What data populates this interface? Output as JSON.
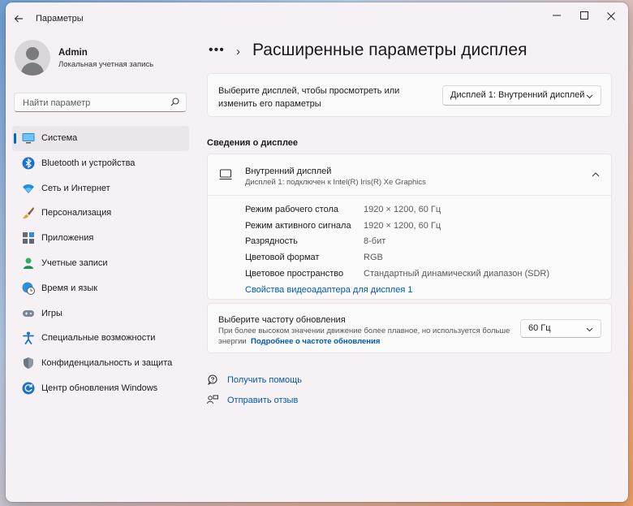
{
  "window": {
    "title": "Параметры",
    "back_icon": "arrow-left-icon",
    "controls": [
      "minimize",
      "maximize",
      "close"
    ]
  },
  "user": {
    "name": "Admin",
    "account_type": "Локальная учетная запись"
  },
  "search": {
    "placeholder": "Найти параметр"
  },
  "sidebar": {
    "items": [
      {
        "label": "Система",
        "icon": "system-display-icon",
        "active": true
      },
      {
        "label": "Bluetooth и устройства",
        "icon": "bluetooth-icon"
      },
      {
        "label": "Сеть и Интернет",
        "icon": "wifi-icon"
      },
      {
        "label": "Персонализация",
        "icon": "brush-icon"
      },
      {
        "label": "Приложения",
        "icon": "apps-icon"
      },
      {
        "label": "Учетные записи",
        "icon": "accounts-icon"
      },
      {
        "label": "Время и язык",
        "icon": "globe-clock-icon"
      },
      {
        "label": "Игры",
        "icon": "gamepad-icon"
      },
      {
        "label": "Специальные возможности",
        "icon": "accessibility-icon"
      },
      {
        "label": "Конфиденциальность и защита",
        "icon": "shield-icon"
      },
      {
        "label": "Центр обновления Windows",
        "icon": "windows-update-icon"
      }
    ]
  },
  "header": {
    "more": "•••",
    "separator": "›",
    "title": "Расширенные параметры дисплея"
  },
  "display_select": {
    "label": "Выберите дисплей, чтобы просмотреть или изменить его параметры",
    "selected": "Дисплей 1: Внутренний дисплей"
  },
  "info_section": {
    "heading": "Сведения о дисплее",
    "display_name": "Внутренний дисплей",
    "display_desc": "Дисплей 1: подключен к Intel(R) Iris(R) Xe Graphics",
    "properties": [
      {
        "key": "Режим рабочего стола",
        "value": "1920 × 1200, 60 Гц"
      },
      {
        "key": "Режим активного сигнала",
        "value": "1920 × 1200, 60 Гц"
      },
      {
        "key": "Разрядность",
        "value": "8-бит"
      },
      {
        "key": "Цветовой формат",
        "value": "RGB"
      },
      {
        "key": "Цветовое пространство",
        "value": "Стандартный динамический диапазон (SDR)"
      }
    ],
    "adapter_link": "Свойства видеоадаптера для дисплея 1"
  },
  "refresh": {
    "title": "Выберите частоту обновления",
    "desc": "При более высоком значении движение более плавное, но используется больше энергии",
    "link": "Подробнее о частоте обновления",
    "selected": "60 Гц"
  },
  "help": {
    "get_help": "Получить помощь",
    "feedback": "Отправить отзыв"
  },
  "colors": {
    "accent": "#0067c0",
    "link": "#0059ad"
  }
}
